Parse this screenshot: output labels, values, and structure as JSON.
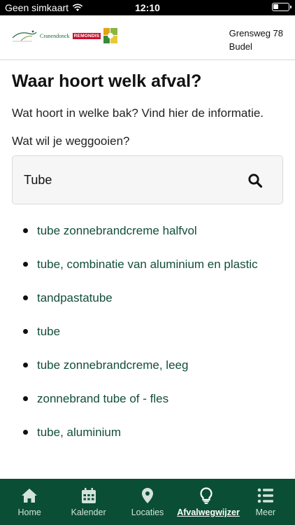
{
  "status_bar": {
    "carrier": "Geen simkaart",
    "time": "12:10"
  },
  "header": {
    "logos": {
      "municipality": "Cranendonck",
      "partner": "REMONDIS"
    },
    "address_line1": "Grensweg 78",
    "address_line2": "Budel"
  },
  "main": {
    "title": "Waar hoort welk afval?",
    "intro": "Wat hoort in welke bak? Vind hier de informatie.",
    "question": "Wat wil je weggooien?",
    "search": {
      "value": "Tube"
    },
    "results": [
      "tube zonnebrandcreme halfvol",
      "tube, combinatie van aluminium en plastic",
      "tandpastatube",
      "tube",
      "tube zonnebrandcreme, leeg",
      "zonnebrand tube of - fles",
      "tube, aluminium"
    ]
  },
  "tabbar": {
    "active": "Afvalwegwijzer",
    "tabs": [
      {
        "label": "Home",
        "icon": "home-icon"
      },
      {
        "label": "Kalender",
        "icon": "calendar-icon"
      },
      {
        "label": "Locaties",
        "icon": "map-pin-icon"
      },
      {
        "label": "Afvalwegwijzer",
        "icon": "lightbulb-icon"
      },
      {
        "label": "Meer",
        "icon": "list-icon"
      }
    ]
  },
  "colors": {
    "brand_green": "#0a4e36",
    "link_green": "#124e37",
    "remondis_red": "#c8102e"
  }
}
